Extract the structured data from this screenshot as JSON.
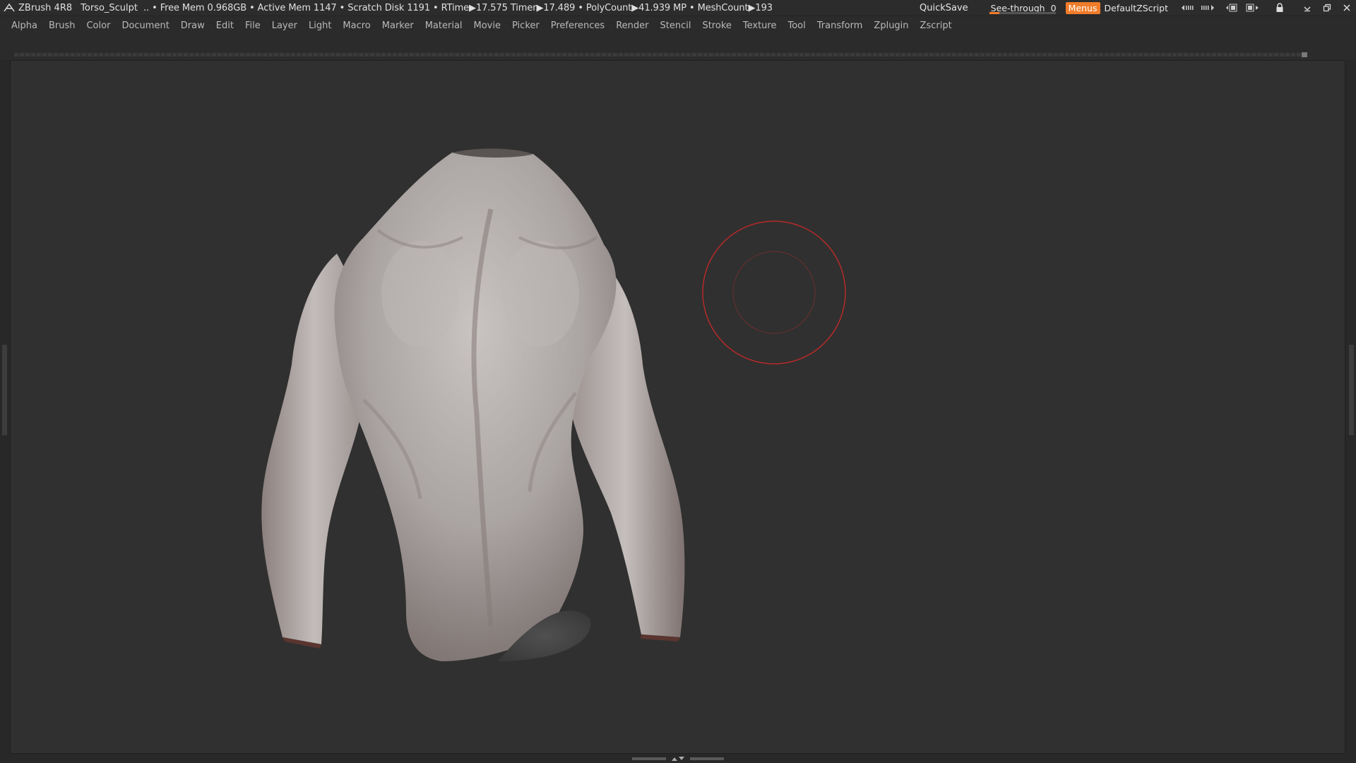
{
  "titlebar": {
    "app_name": "ZBrush 4R8",
    "document_name": "Torso_Sculpt",
    "stats": ".. • Free Mem 0.968GB • Active Mem 1147 • Scratch Disk 1191 • RTime▶17.575 Timer▶17.489 • PolyCount▶41.939 MP • MeshCount▶193",
    "quicksave_label": "QuickSave",
    "seethrough_label": "See-through",
    "seethrough_value": "0",
    "seethrough_level": 0,
    "menus_label": "Menus",
    "script_label": "DefaultZScript"
  },
  "menubar": {
    "items": [
      "Alpha",
      "Brush",
      "Color",
      "Document",
      "Draw",
      "Edit",
      "File",
      "Layer",
      "Light",
      "Macro",
      "Marker",
      "Material",
      "Movie",
      "Picker",
      "Preferences",
      "Render",
      "Stencil",
      "Stroke",
      "Texture",
      "Tool",
      "Transform",
      "Zplugin",
      "Zscript"
    ]
  },
  "colors": {
    "accent": "#f07c2a",
    "canvas_bg": "#303030",
    "ui_bg": "#2b2b2b",
    "brush_cursor": "#b52a2a"
  },
  "icons": {
    "logo": "zbrush-logo-icon",
    "minimize": "minimize-icon",
    "restore": "restore-icon",
    "close": "close-icon"
  }
}
